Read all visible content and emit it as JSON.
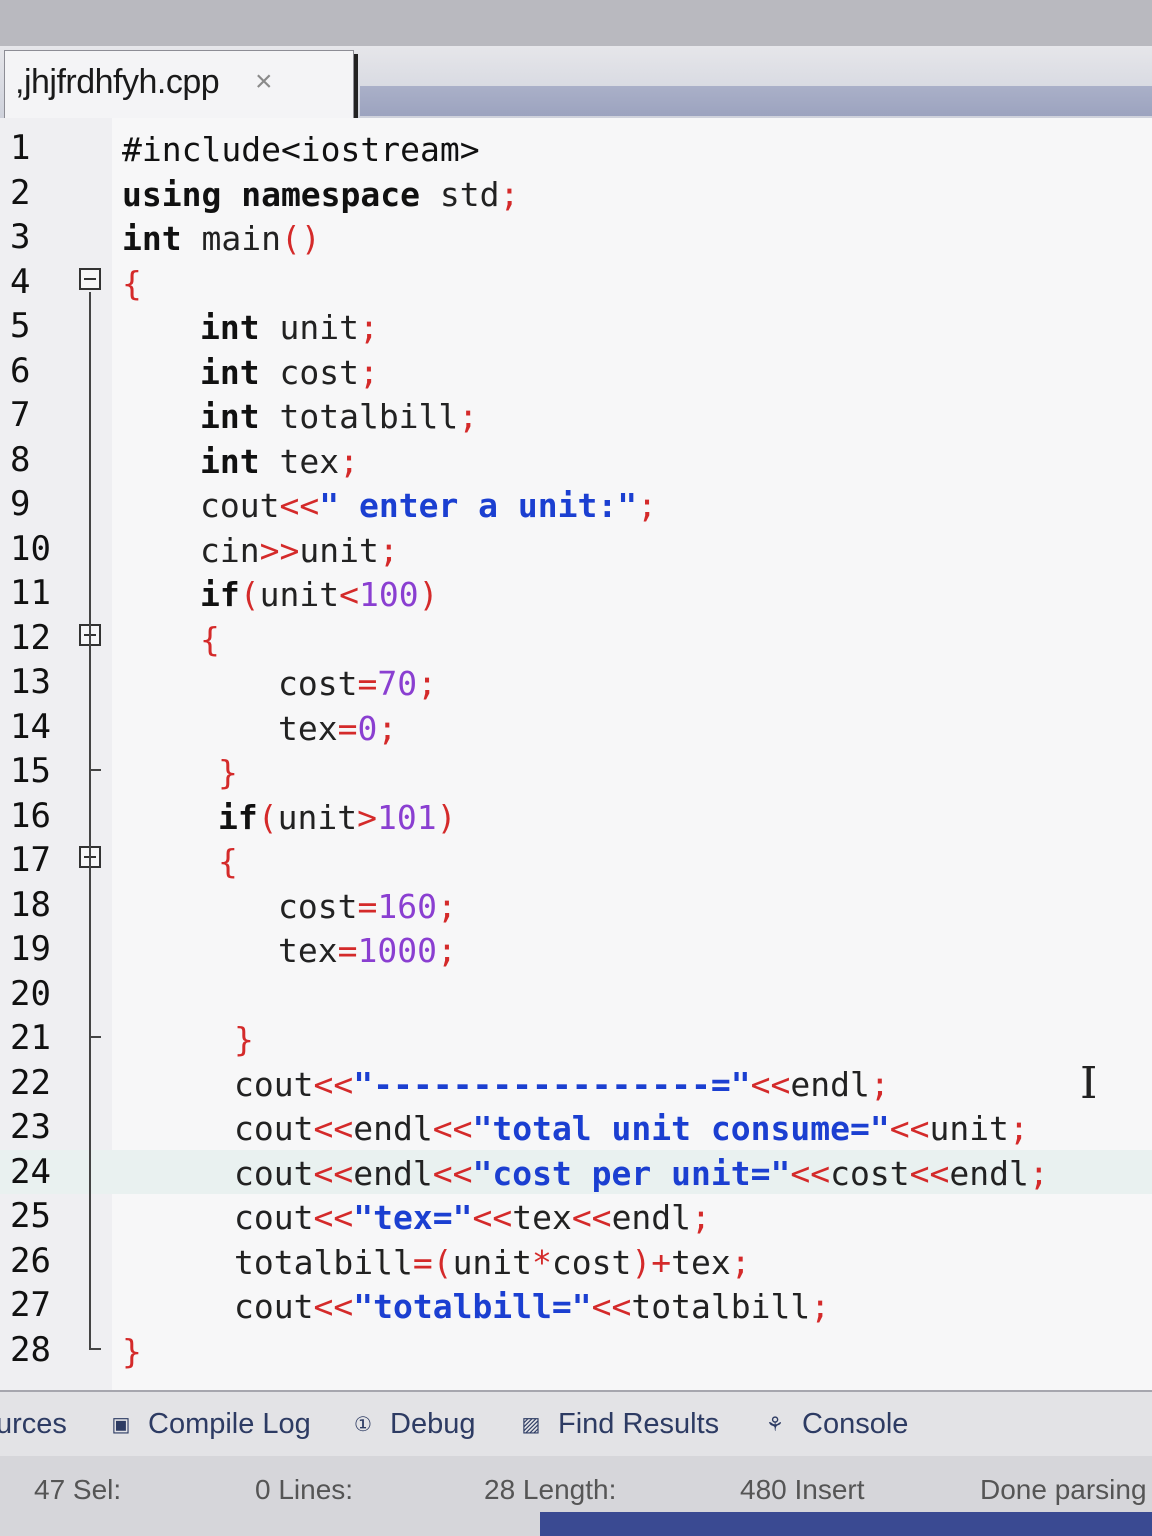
{
  "tab": {
    "filename": ",jhjfrdhfyh.cpp",
    "close_glyph": "×"
  },
  "editor": {
    "lines": [
      {
        "n": "1",
        "tokens": [
          {
            "t": "#include<iostream>",
            "c": "pp"
          }
        ]
      },
      {
        "n": "2",
        "tokens": [
          {
            "t": "using namespace",
            "c": "kw"
          },
          {
            "t": " std",
            "c": ""
          },
          {
            "t": ";",
            "c": "sym"
          }
        ]
      },
      {
        "n": "3",
        "tokens": [
          {
            "t": "int",
            "c": "kw"
          },
          {
            "t": " main",
            "c": ""
          },
          {
            "t": "()",
            "c": "sym"
          }
        ]
      },
      {
        "n": "4",
        "tokens": [
          {
            "t": "{",
            "c": "sym"
          }
        ]
      },
      {
        "n": "5",
        "tokens": [
          {
            "t": "int",
            "c": "kw"
          },
          {
            "t": " unit",
            "c": ""
          },
          {
            "t": ";",
            "c": "sym"
          }
        ]
      },
      {
        "n": "6",
        "tokens": [
          {
            "t": "int",
            "c": "kw"
          },
          {
            "t": " cost",
            "c": ""
          },
          {
            "t": ";",
            "c": "sym"
          }
        ]
      },
      {
        "n": "7",
        "tokens": [
          {
            "t": "int",
            "c": "kw"
          },
          {
            "t": " totalbill",
            "c": ""
          },
          {
            "t": ";",
            "c": "sym"
          }
        ]
      },
      {
        "n": "8",
        "tokens": [
          {
            "t": "int",
            "c": "kw"
          },
          {
            "t": " tex",
            "c": ""
          },
          {
            "t": ";",
            "c": "sym"
          }
        ]
      },
      {
        "n": "9",
        "tokens": [
          {
            "t": "cout",
            "c": ""
          },
          {
            "t": "<<",
            "c": "sym"
          },
          {
            "t": "\" enter a unit:\"",
            "c": "str"
          },
          {
            "t": ";",
            "c": "sym"
          }
        ]
      },
      {
        "n": "10",
        "tokens": [
          {
            "t": "cin",
            "c": ""
          },
          {
            "t": ">>",
            "c": "sym"
          },
          {
            "t": "unit",
            "c": ""
          },
          {
            "t": ";",
            "c": "sym"
          }
        ]
      },
      {
        "n": "11",
        "tokens": [
          {
            "t": "if",
            "c": "kw"
          },
          {
            "t": "(",
            "c": "sym"
          },
          {
            "t": "unit",
            "c": ""
          },
          {
            "t": "<",
            "c": "sym"
          },
          {
            "t": "100",
            "c": "num"
          },
          {
            "t": ")",
            "c": "sym"
          }
        ]
      },
      {
        "n": "12",
        "tokens": [
          {
            "t": "{",
            "c": "sym"
          }
        ]
      },
      {
        "n": "13",
        "tokens": [
          {
            "t": "cost",
            "c": ""
          },
          {
            "t": "=",
            "c": "sym"
          },
          {
            "t": "70",
            "c": "num"
          },
          {
            "t": ";",
            "c": "sym"
          }
        ]
      },
      {
        "n": "14",
        "tokens": [
          {
            "t": "tex",
            "c": ""
          },
          {
            "t": "=",
            "c": "sym"
          },
          {
            "t": "0",
            "c": "num"
          },
          {
            "t": ";",
            "c": "sym"
          }
        ]
      },
      {
        "n": "15",
        "tokens": [
          {
            "t": "}",
            "c": "sym"
          }
        ]
      },
      {
        "n": "16",
        "tokens": [
          {
            "t": "if",
            "c": "kw"
          },
          {
            "t": "(",
            "c": "sym"
          },
          {
            "t": "unit",
            "c": ""
          },
          {
            "t": ">",
            "c": "sym"
          },
          {
            "t": "101",
            "c": "num"
          },
          {
            "t": ")",
            "c": "sym"
          }
        ]
      },
      {
        "n": "17",
        "tokens": [
          {
            "t": "{",
            "c": "sym"
          }
        ]
      },
      {
        "n": "18",
        "tokens": [
          {
            "t": "cost",
            "c": ""
          },
          {
            "t": "=",
            "c": "sym"
          },
          {
            "t": "160",
            "c": "num"
          },
          {
            "t": ";",
            "c": "sym"
          }
        ]
      },
      {
        "n": "19",
        "tokens": [
          {
            "t": "tex",
            "c": ""
          },
          {
            "t": "=",
            "c": "sym"
          },
          {
            "t": "1000",
            "c": "num"
          },
          {
            "t": ";",
            "c": "sym"
          }
        ]
      },
      {
        "n": "20",
        "tokens": []
      },
      {
        "n": "21",
        "tokens": [
          {
            "t": "}",
            "c": "sym"
          }
        ]
      },
      {
        "n": "22",
        "tokens": [
          {
            "t": "cout",
            "c": ""
          },
          {
            "t": "<<",
            "c": "sym"
          },
          {
            "t": "\"-----------------=\"",
            "c": "str"
          },
          {
            "t": "<<",
            "c": "sym"
          },
          {
            "t": "endl",
            "c": ""
          },
          {
            "t": ";",
            "c": "sym"
          }
        ]
      },
      {
        "n": "23",
        "tokens": [
          {
            "t": "cout",
            "c": ""
          },
          {
            "t": "<<",
            "c": "sym"
          },
          {
            "t": "endl",
            "c": ""
          },
          {
            "t": "<<",
            "c": "sym"
          },
          {
            "t": "\"total unit consume=\"",
            "c": "str"
          },
          {
            "t": "<<",
            "c": "sym"
          },
          {
            "t": "unit",
            "c": ""
          },
          {
            "t": ";",
            "c": "sym"
          }
        ]
      },
      {
        "n": "24",
        "tokens": [
          {
            "t": "cout",
            "c": ""
          },
          {
            "t": "<<",
            "c": "sym"
          },
          {
            "t": "endl",
            "c": ""
          },
          {
            "t": "<<",
            "c": "sym"
          },
          {
            "t": "\"cost per unit=\"",
            "c": "str"
          },
          {
            "t": "<<",
            "c": "sym"
          },
          {
            "t": "cost",
            "c": ""
          },
          {
            "t": "<<",
            "c": "sym"
          },
          {
            "t": "endl",
            "c": ""
          },
          {
            "t": ";",
            "c": "sym"
          }
        ]
      },
      {
        "n": "25",
        "tokens": [
          {
            "t": "cout",
            "c": ""
          },
          {
            "t": "<<",
            "c": "sym"
          },
          {
            "t": "\"tex=\"",
            "c": "str"
          },
          {
            "t": "<<",
            "c": "sym"
          },
          {
            "t": "tex",
            "c": ""
          },
          {
            "t": "<<",
            "c": "sym"
          },
          {
            "t": "endl",
            "c": ""
          },
          {
            "t": ";",
            "c": "sym"
          }
        ]
      },
      {
        "n": "26",
        "tokens": [
          {
            "t": "totalbill",
            "c": ""
          },
          {
            "t": "=(",
            "c": "sym"
          },
          {
            "t": "unit",
            "c": ""
          },
          {
            "t": "*",
            "c": "sym"
          },
          {
            "t": "cost",
            "c": ""
          },
          {
            "t": ")+",
            "c": "sym"
          },
          {
            "t": "tex",
            "c": ""
          },
          {
            "t": ";",
            "c": "sym"
          }
        ]
      },
      {
        "n": "27",
        "tokens": [
          {
            "t": "cout",
            "c": ""
          },
          {
            "t": "<<",
            "c": "sym"
          },
          {
            "t": "\"totalbill=\"",
            "c": "str"
          },
          {
            "t": "<<",
            "c": "sym"
          },
          {
            "t": "totalbill",
            "c": ""
          },
          {
            "t": ";",
            "c": "sym"
          }
        ]
      },
      {
        "n": "28",
        "tokens": [
          {
            "t": "}",
            "c": "sym"
          }
        ]
      }
    ],
    "current_line": "24",
    "fold_lines": [
      "4",
      "12",
      "17"
    ]
  },
  "panel_tabs": [
    {
      "label": "urces",
      "icon": "resources-icon"
    },
    {
      "label": "Compile Log",
      "icon": "compile-log-icon"
    },
    {
      "label": "Debug",
      "icon": "debug-icon"
    },
    {
      "label": "Find Results",
      "icon": "find-results-icon"
    },
    {
      "label": "Console",
      "icon": "console-icon"
    }
  ],
  "status": {
    "sel": "47 Sel:",
    "lines": "0 Lines:",
    "length": "28 Length:",
    "insert": "480 Insert",
    "parsing": "Done parsing"
  },
  "colors": {
    "keyword": "#111111",
    "symbol": "#d42a2a",
    "number": "#8a3fd1",
    "string": "#1b3fd1",
    "status_accent": "#3a4a92"
  }
}
